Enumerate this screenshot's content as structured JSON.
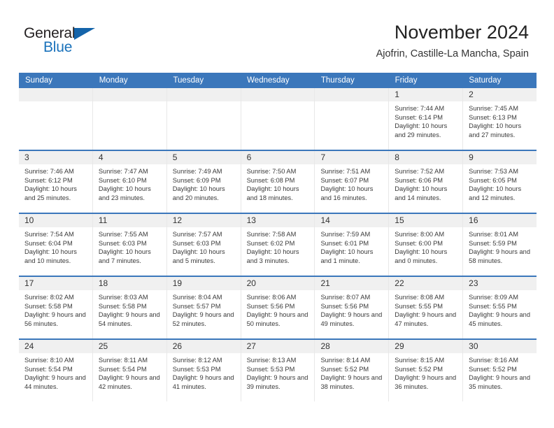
{
  "brand": {
    "name_top": "General",
    "name_bottom": "Blue",
    "accent_color": "#1a72bb",
    "triangle_color": "#1464aa"
  },
  "header": {
    "title": "November 2024",
    "subtitle": "Ajofrin, Castille-La Mancha, Spain"
  },
  "calendar": {
    "header_bg": "#3b77bb",
    "date_band_bg": "#f0f0f0",
    "weekdays": [
      "Sunday",
      "Monday",
      "Tuesday",
      "Wednesday",
      "Thursday",
      "Friday",
      "Saturday"
    ],
    "weeks": [
      [
        {
          "empty": true
        },
        {
          "empty": true
        },
        {
          "empty": true
        },
        {
          "empty": true
        },
        {
          "empty": true
        },
        {
          "date": "1",
          "sunrise": "Sunrise: 7:44 AM",
          "sunset": "Sunset: 6:14 PM",
          "daylight": "Daylight: 10 hours and 29 minutes."
        },
        {
          "date": "2",
          "sunrise": "Sunrise: 7:45 AM",
          "sunset": "Sunset: 6:13 PM",
          "daylight": "Daylight: 10 hours and 27 minutes."
        }
      ],
      [
        {
          "date": "3",
          "sunrise": "Sunrise: 7:46 AM",
          "sunset": "Sunset: 6:12 PM",
          "daylight": "Daylight: 10 hours and 25 minutes."
        },
        {
          "date": "4",
          "sunrise": "Sunrise: 7:47 AM",
          "sunset": "Sunset: 6:10 PM",
          "daylight": "Daylight: 10 hours and 23 minutes."
        },
        {
          "date": "5",
          "sunrise": "Sunrise: 7:49 AM",
          "sunset": "Sunset: 6:09 PM",
          "daylight": "Daylight: 10 hours and 20 minutes."
        },
        {
          "date": "6",
          "sunrise": "Sunrise: 7:50 AM",
          "sunset": "Sunset: 6:08 PM",
          "daylight": "Daylight: 10 hours and 18 minutes."
        },
        {
          "date": "7",
          "sunrise": "Sunrise: 7:51 AM",
          "sunset": "Sunset: 6:07 PM",
          "daylight": "Daylight: 10 hours and 16 minutes."
        },
        {
          "date": "8",
          "sunrise": "Sunrise: 7:52 AM",
          "sunset": "Sunset: 6:06 PM",
          "daylight": "Daylight: 10 hours and 14 minutes."
        },
        {
          "date": "9",
          "sunrise": "Sunrise: 7:53 AM",
          "sunset": "Sunset: 6:05 PM",
          "daylight": "Daylight: 10 hours and 12 minutes."
        }
      ],
      [
        {
          "date": "10",
          "sunrise": "Sunrise: 7:54 AM",
          "sunset": "Sunset: 6:04 PM",
          "daylight": "Daylight: 10 hours and 10 minutes."
        },
        {
          "date": "11",
          "sunrise": "Sunrise: 7:55 AM",
          "sunset": "Sunset: 6:03 PM",
          "daylight": "Daylight: 10 hours and 7 minutes."
        },
        {
          "date": "12",
          "sunrise": "Sunrise: 7:57 AM",
          "sunset": "Sunset: 6:03 PM",
          "daylight": "Daylight: 10 hours and 5 minutes."
        },
        {
          "date": "13",
          "sunrise": "Sunrise: 7:58 AM",
          "sunset": "Sunset: 6:02 PM",
          "daylight": "Daylight: 10 hours and 3 minutes."
        },
        {
          "date": "14",
          "sunrise": "Sunrise: 7:59 AM",
          "sunset": "Sunset: 6:01 PM",
          "daylight": "Daylight: 10 hours and 1 minute."
        },
        {
          "date": "15",
          "sunrise": "Sunrise: 8:00 AM",
          "sunset": "Sunset: 6:00 PM",
          "daylight": "Daylight: 10 hours and 0 minutes."
        },
        {
          "date": "16",
          "sunrise": "Sunrise: 8:01 AM",
          "sunset": "Sunset: 5:59 PM",
          "daylight": "Daylight: 9 hours and 58 minutes."
        }
      ],
      [
        {
          "date": "17",
          "sunrise": "Sunrise: 8:02 AM",
          "sunset": "Sunset: 5:58 PM",
          "daylight": "Daylight: 9 hours and 56 minutes."
        },
        {
          "date": "18",
          "sunrise": "Sunrise: 8:03 AM",
          "sunset": "Sunset: 5:58 PM",
          "daylight": "Daylight: 9 hours and 54 minutes."
        },
        {
          "date": "19",
          "sunrise": "Sunrise: 8:04 AM",
          "sunset": "Sunset: 5:57 PM",
          "daylight": "Daylight: 9 hours and 52 minutes."
        },
        {
          "date": "20",
          "sunrise": "Sunrise: 8:06 AM",
          "sunset": "Sunset: 5:56 PM",
          "daylight": "Daylight: 9 hours and 50 minutes."
        },
        {
          "date": "21",
          "sunrise": "Sunrise: 8:07 AM",
          "sunset": "Sunset: 5:56 PM",
          "daylight": "Daylight: 9 hours and 49 minutes."
        },
        {
          "date": "22",
          "sunrise": "Sunrise: 8:08 AM",
          "sunset": "Sunset: 5:55 PM",
          "daylight": "Daylight: 9 hours and 47 minutes."
        },
        {
          "date": "23",
          "sunrise": "Sunrise: 8:09 AM",
          "sunset": "Sunset: 5:55 PM",
          "daylight": "Daylight: 9 hours and 45 minutes."
        }
      ],
      [
        {
          "date": "24",
          "sunrise": "Sunrise: 8:10 AM",
          "sunset": "Sunset: 5:54 PM",
          "daylight": "Daylight: 9 hours and 44 minutes."
        },
        {
          "date": "25",
          "sunrise": "Sunrise: 8:11 AM",
          "sunset": "Sunset: 5:54 PM",
          "daylight": "Daylight: 9 hours and 42 minutes."
        },
        {
          "date": "26",
          "sunrise": "Sunrise: 8:12 AM",
          "sunset": "Sunset: 5:53 PM",
          "daylight": "Daylight: 9 hours and 41 minutes."
        },
        {
          "date": "27",
          "sunrise": "Sunrise: 8:13 AM",
          "sunset": "Sunset: 5:53 PM",
          "daylight": "Daylight: 9 hours and 39 minutes."
        },
        {
          "date": "28",
          "sunrise": "Sunrise: 8:14 AM",
          "sunset": "Sunset: 5:52 PM",
          "daylight": "Daylight: 9 hours and 38 minutes."
        },
        {
          "date": "29",
          "sunrise": "Sunrise: 8:15 AM",
          "sunset": "Sunset: 5:52 PM",
          "daylight": "Daylight: 9 hours and 36 minutes."
        },
        {
          "date": "30",
          "sunrise": "Sunrise: 8:16 AM",
          "sunset": "Sunset: 5:52 PM",
          "daylight": "Daylight: 9 hours and 35 minutes."
        }
      ]
    ]
  }
}
